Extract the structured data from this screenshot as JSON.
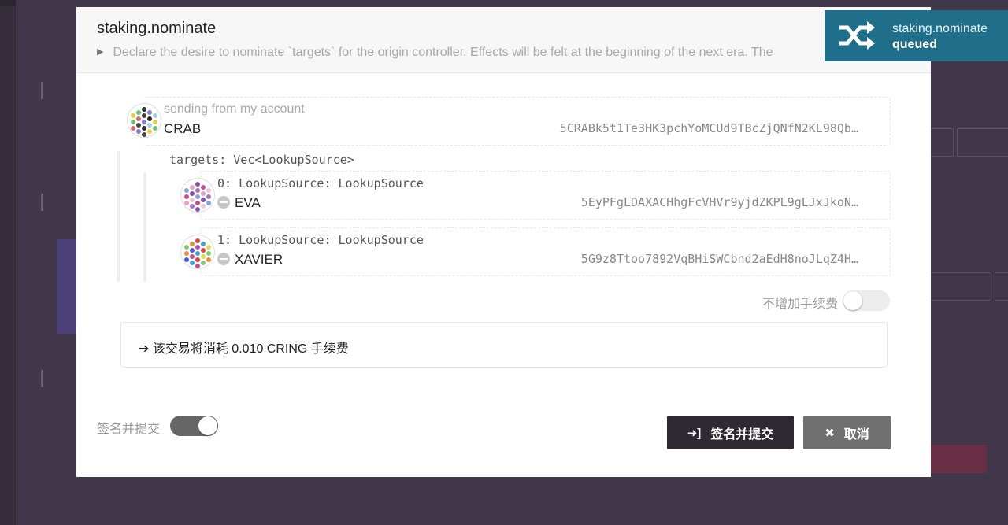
{
  "modal": {
    "title": "staking.nominate",
    "description": "Declare the desire to nominate `targets` for the origin controller. Effects will be felt at the beginning of the next era. The"
  },
  "sender": {
    "label": "sending from my account",
    "name": "CRAB",
    "address": "5CRABk5t1Te3HK3pchYoMCUd9TBcZjQNfN2KL98Qb…"
  },
  "targets": {
    "label": "targets: Vec<LookupSource>",
    "items": [
      {
        "label": "0: LookupSource: LookupSource",
        "name": "EVA",
        "address": "5EyPFgLDAXACHhgFcVHVr9yjdZKPL9gLJxJkoN…"
      },
      {
        "label": "1: LookupSource: LookupSource",
        "name": "XAVIER",
        "address": "5G9z8Ttoo7892VqBHiSWCbnd2aEdH8noJLqZ4H…"
      }
    ]
  },
  "tip": {
    "label": "不增加手续费",
    "enabled": false
  },
  "fee": {
    "text": "该交易将消耗 0.010 CRING 手续费",
    "arrow_icon": "arrow-right-icon"
  },
  "sign": {
    "label": "签名并提交",
    "enabled": true
  },
  "buttons": {
    "submit": {
      "label": "签名并提交",
      "icon": "sign-in-icon",
      "color": "#2d2a33"
    },
    "cancel": {
      "label": "取消",
      "icon": "close-icon",
      "color": "#707070"
    }
  },
  "notification": {
    "title": "staking.nominate",
    "status": "queued",
    "icon": "shuffle-icon",
    "color": "#1f6f8b"
  }
}
